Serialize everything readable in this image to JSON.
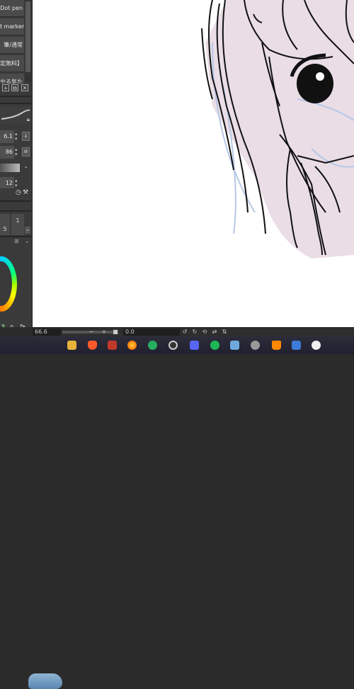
{
  "brush_list": {
    "items": [
      "Dot pen",
      "t marker",
      "筆/通常",
      "定無料】",
      "やる気た"
    ]
  },
  "brush_tools": {
    "icons": [
      "new-brush-icon",
      "duplicate-icon",
      "delete-icon"
    ]
  },
  "properties": {
    "size": "6.1",
    "opacity": "86",
    "value3": "12"
  },
  "panel_values": {
    "row_a": "5",
    "row_a_aux": "1"
  },
  "color_panel": {
    "value": "0"
  },
  "status_bar": {
    "zoom": "66.6",
    "angle": "0.0"
  },
  "taskbar": {
    "apps": [
      "folder",
      "brave",
      "app-red",
      "firefox",
      "xbox",
      "app-dark",
      "discord",
      "spotify",
      "photos",
      "app-gray",
      "vlc",
      "app-blue",
      "app-white"
    ]
  },
  "colors": {
    "canvas": "#ffffff",
    "panel": "#3a3a3a",
    "ink": "#111111",
    "skin": "#eadde6",
    "sketch": "#b7c8e6"
  }
}
